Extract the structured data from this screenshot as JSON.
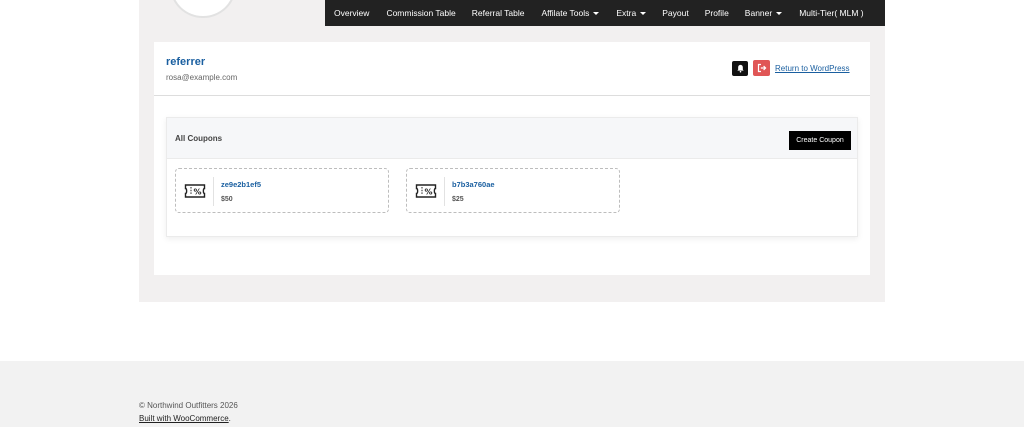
{
  "nav": {
    "items": [
      {
        "label": "Overview",
        "dropdown": false
      },
      {
        "label": "Commission Table",
        "dropdown": false
      },
      {
        "label": "Referral Table",
        "dropdown": false
      },
      {
        "label": "Affilate Tools",
        "dropdown": true
      },
      {
        "label": "Extra",
        "dropdown": true
      },
      {
        "label": "Payout",
        "dropdown": false
      },
      {
        "label": "Profile",
        "dropdown": false
      },
      {
        "label": "Banner",
        "dropdown": true
      },
      {
        "label": "Multi-Tier( MLM )",
        "dropdown": false
      }
    ]
  },
  "user": {
    "name": "referrer",
    "email": "rosa@example.com"
  },
  "header_actions": {
    "notification_icon": "bell-icon",
    "logout_icon": "logout-icon",
    "return_link": "Return to WordPress"
  },
  "coupons": {
    "title": "All Coupons",
    "create_label": "Create Coupon",
    "items": [
      {
        "code": "ze9e2b1ef5",
        "amount": "$50"
      },
      {
        "code": "b7b3a760ae",
        "amount": "$25"
      }
    ]
  },
  "footer": {
    "copyright": "© Northwind Outfitters 2026",
    "built_with_link": "Built with WooCommerce",
    "built_with_suffix": "."
  },
  "colors": {
    "nav_bg": "#222222",
    "accent_link": "#1a5fa0",
    "logout_red": "#e05656",
    "button_black": "#000000"
  }
}
